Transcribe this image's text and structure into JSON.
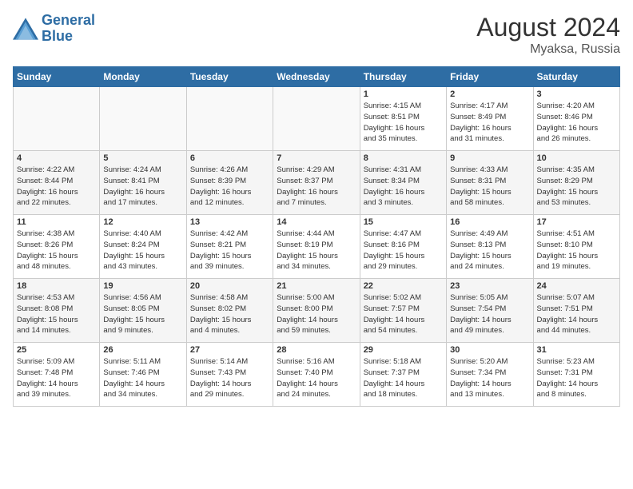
{
  "header": {
    "logo_line1": "General",
    "logo_line2": "Blue",
    "month_year": "August 2024",
    "location": "Myaksa, Russia"
  },
  "days_of_week": [
    "Sunday",
    "Monday",
    "Tuesday",
    "Wednesday",
    "Thursday",
    "Friday",
    "Saturday"
  ],
  "weeks": [
    [
      {
        "num": "",
        "info": ""
      },
      {
        "num": "",
        "info": ""
      },
      {
        "num": "",
        "info": ""
      },
      {
        "num": "",
        "info": ""
      },
      {
        "num": "1",
        "info": "Sunrise: 4:15 AM\nSunset: 8:51 PM\nDaylight: 16 hours\nand 35 minutes."
      },
      {
        "num": "2",
        "info": "Sunrise: 4:17 AM\nSunset: 8:49 PM\nDaylight: 16 hours\nand 31 minutes."
      },
      {
        "num": "3",
        "info": "Sunrise: 4:20 AM\nSunset: 8:46 PM\nDaylight: 16 hours\nand 26 minutes."
      }
    ],
    [
      {
        "num": "4",
        "info": "Sunrise: 4:22 AM\nSunset: 8:44 PM\nDaylight: 16 hours\nand 22 minutes."
      },
      {
        "num": "5",
        "info": "Sunrise: 4:24 AM\nSunset: 8:41 PM\nDaylight: 16 hours\nand 17 minutes."
      },
      {
        "num": "6",
        "info": "Sunrise: 4:26 AM\nSunset: 8:39 PM\nDaylight: 16 hours\nand 12 minutes."
      },
      {
        "num": "7",
        "info": "Sunrise: 4:29 AM\nSunset: 8:37 PM\nDaylight: 16 hours\nand 7 minutes."
      },
      {
        "num": "8",
        "info": "Sunrise: 4:31 AM\nSunset: 8:34 PM\nDaylight: 16 hours\nand 3 minutes."
      },
      {
        "num": "9",
        "info": "Sunrise: 4:33 AM\nSunset: 8:31 PM\nDaylight: 15 hours\nand 58 minutes."
      },
      {
        "num": "10",
        "info": "Sunrise: 4:35 AM\nSunset: 8:29 PM\nDaylight: 15 hours\nand 53 minutes."
      }
    ],
    [
      {
        "num": "11",
        "info": "Sunrise: 4:38 AM\nSunset: 8:26 PM\nDaylight: 15 hours\nand 48 minutes."
      },
      {
        "num": "12",
        "info": "Sunrise: 4:40 AM\nSunset: 8:24 PM\nDaylight: 15 hours\nand 43 minutes."
      },
      {
        "num": "13",
        "info": "Sunrise: 4:42 AM\nSunset: 8:21 PM\nDaylight: 15 hours\nand 39 minutes."
      },
      {
        "num": "14",
        "info": "Sunrise: 4:44 AM\nSunset: 8:19 PM\nDaylight: 15 hours\nand 34 minutes."
      },
      {
        "num": "15",
        "info": "Sunrise: 4:47 AM\nSunset: 8:16 PM\nDaylight: 15 hours\nand 29 minutes."
      },
      {
        "num": "16",
        "info": "Sunrise: 4:49 AM\nSunset: 8:13 PM\nDaylight: 15 hours\nand 24 minutes."
      },
      {
        "num": "17",
        "info": "Sunrise: 4:51 AM\nSunset: 8:10 PM\nDaylight: 15 hours\nand 19 minutes."
      }
    ],
    [
      {
        "num": "18",
        "info": "Sunrise: 4:53 AM\nSunset: 8:08 PM\nDaylight: 15 hours\nand 14 minutes."
      },
      {
        "num": "19",
        "info": "Sunrise: 4:56 AM\nSunset: 8:05 PM\nDaylight: 15 hours\nand 9 minutes."
      },
      {
        "num": "20",
        "info": "Sunrise: 4:58 AM\nSunset: 8:02 PM\nDaylight: 15 hours\nand 4 minutes."
      },
      {
        "num": "21",
        "info": "Sunrise: 5:00 AM\nSunset: 8:00 PM\nDaylight: 14 hours\nand 59 minutes."
      },
      {
        "num": "22",
        "info": "Sunrise: 5:02 AM\nSunset: 7:57 PM\nDaylight: 14 hours\nand 54 minutes."
      },
      {
        "num": "23",
        "info": "Sunrise: 5:05 AM\nSunset: 7:54 PM\nDaylight: 14 hours\nand 49 minutes."
      },
      {
        "num": "24",
        "info": "Sunrise: 5:07 AM\nSunset: 7:51 PM\nDaylight: 14 hours\nand 44 minutes."
      }
    ],
    [
      {
        "num": "25",
        "info": "Sunrise: 5:09 AM\nSunset: 7:48 PM\nDaylight: 14 hours\nand 39 minutes."
      },
      {
        "num": "26",
        "info": "Sunrise: 5:11 AM\nSunset: 7:46 PM\nDaylight: 14 hours\nand 34 minutes."
      },
      {
        "num": "27",
        "info": "Sunrise: 5:14 AM\nSunset: 7:43 PM\nDaylight: 14 hours\nand 29 minutes."
      },
      {
        "num": "28",
        "info": "Sunrise: 5:16 AM\nSunset: 7:40 PM\nDaylight: 14 hours\nand 24 minutes."
      },
      {
        "num": "29",
        "info": "Sunrise: 5:18 AM\nSunset: 7:37 PM\nDaylight: 14 hours\nand 18 minutes."
      },
      {
        "num": "30",
        "info": "Sunrise: 5:20 AM\nSunset: 7:34 PM\nDaylight: 14 hours\nand 13 minutes."
      },
      {
        "num": "31",
        "info": "Sunrise: 5:23 AM\nSunset: 7:31 PM\nDaylight: 14 hours\nand 8 minutes."
      }
    ]
  ]
}
